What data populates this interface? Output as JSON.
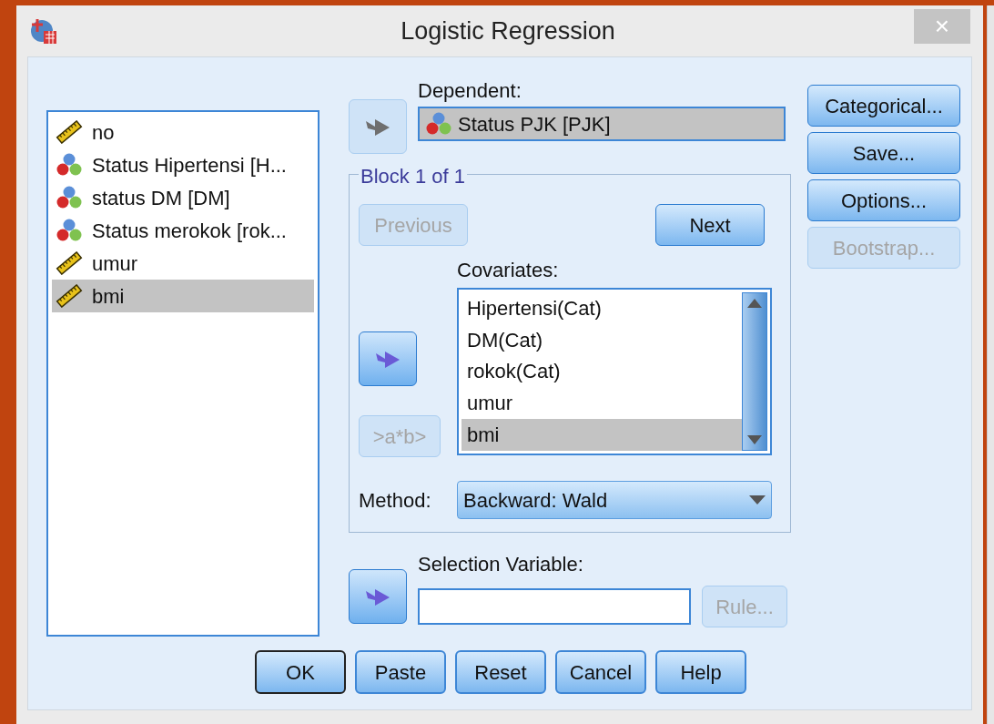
{
  "window": {
    "title": "Logistic Regression",
    "close": "×"
  },
  "variables": [
    {
      "name": "no",
      "kind": "scale",
      "selected": false
    },
    {
      "name": "Status Hipertensi [H...",
      "kind": "nominal",
      "selected": false
    },
    {
      "name": "status DM [DM]",
      "kind": "nominal",
      "selected": false
    },
    {
      "name": "Status merokok [rok...",
      "kind": "nominal",
      "selected": false
    },
    {
      "name": "umur",
      "kind": "scale",
      "selected": false
    },
    {
      "name": "bmi",
      "kind": "scale",
      "selected": true
    }
  ],
  "dependent": {
    "label": "Dependent:",
    "arrow_disabled": true,
    "value": "Status PJK [PJK]",
    "kind": "nominal"
  },
  "block": {
    "title": "Block 1 of 1",
    "previous": {
      "label": "Previous",
      "disabled": true
    },
    "next": {
      "label": "Next",
      "disabled": false
    },
    "covariates_label": "Covariates:",
    "arrow_disabled": false,
    "interaction": {
      "label": ">a*b>",
      "disabled": true
    },
    "covariates": [
      {
        "name": "Hipertensi(Cat)",
        "selected": false
      },
      {
        "name": "DM(Cat)",
        "selected": false
      },
      {
        "name": "rokok(Cat)",
        "selected": false
      },
      {
        "name": "umur",
        "selected": false
      },
      {
        "name": "bmi",
        "selected": true
      }
    ],
    "method_label": "Method:",
    "method": "Backward: Wald"
  },
  "selection": {
    "label": "Selection Variable:",
    "arrow_disabled": false,
    "rule": {
      "label": "Rule...",
      "disabled": true
    }
  },
  "side_buttons": [
    {
      "label": "Categorical...",
      "disabled": false
    },
    {
      "label": "Save...",
      "disabled": false
    },
    {
      "label": "Options...",
      "disabled": false
    },
    {
      "label": "Bootstrap...",
      "disabled": true
    }
  ],
  "footer_buttons": [
    {
      "label": "OK",
      "default": true
    },
    {
      "label": "Paste",
      "default": false
    },
    {
      "label": "Reset",
      "default": false
    },
    {
      "label": "Cancel",
      "default": false
    },
    {
      "label": "Help",
      "default": false
    }
  ]
}
